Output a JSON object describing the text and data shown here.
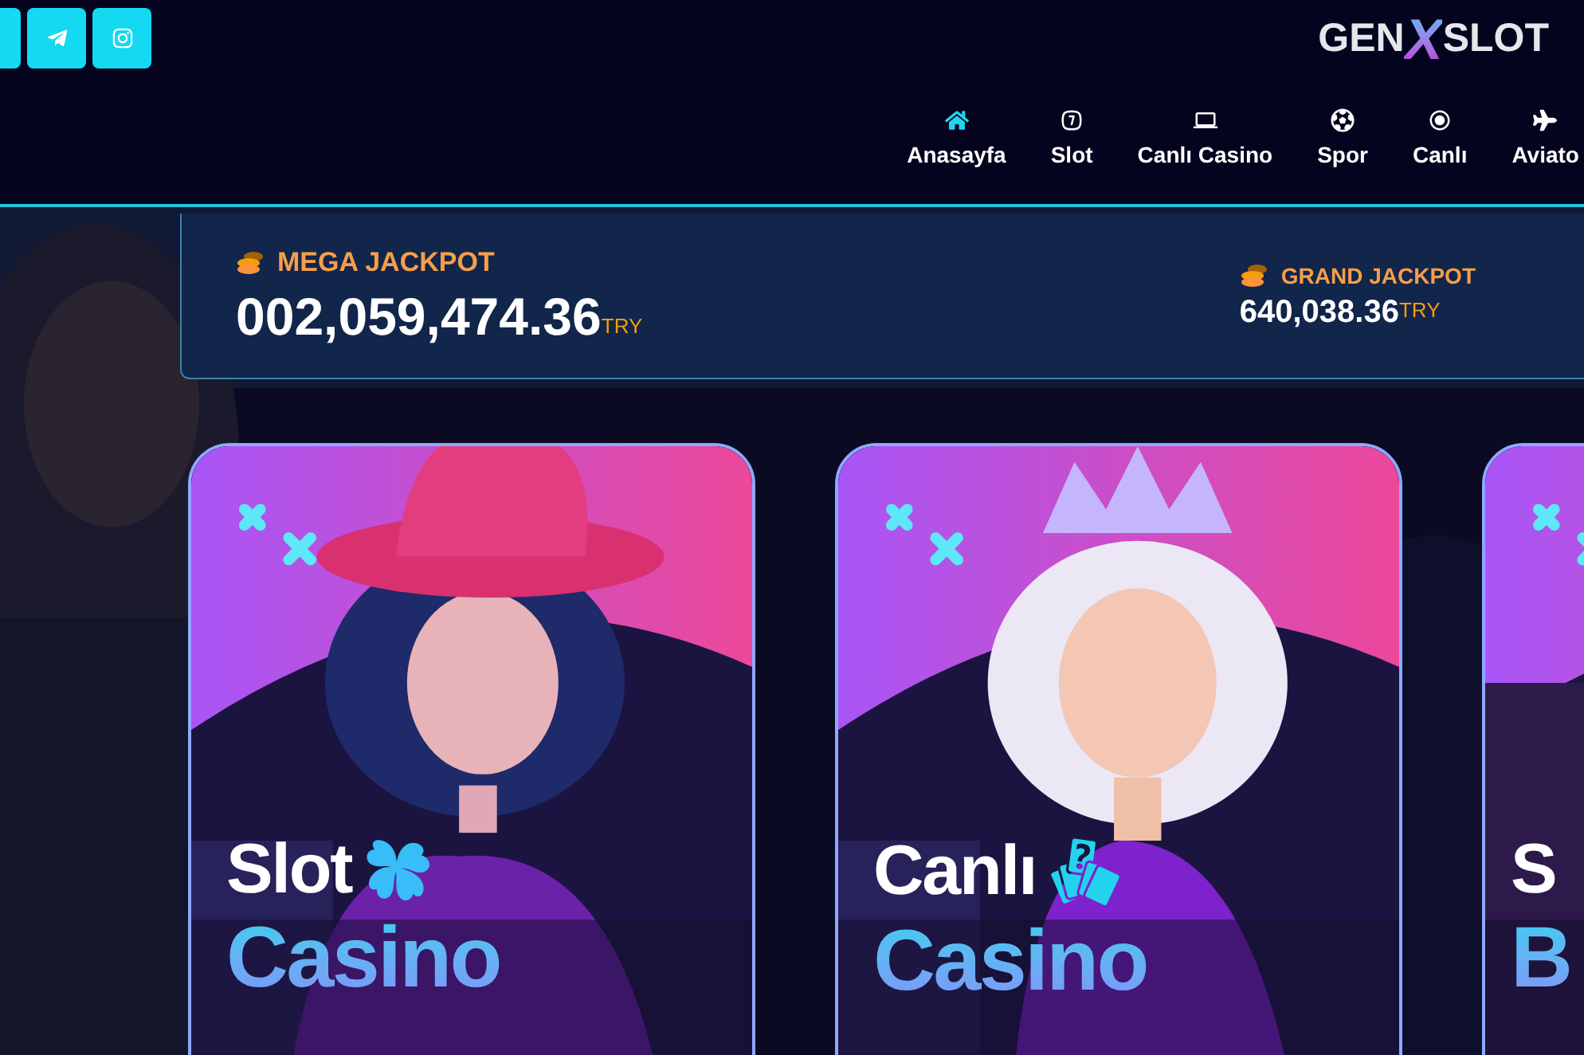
{
  "logo": {
    "left": "GEN",
    "middle": "X",
    "right": "SLOT"
  },
  "nav": [
    {
      "label": "Anasayfa",
      "selected": true
    },
    {
      "label": "Slot",
      "selected": false
    },
    {
      "label": "Canlı Casino",
      "selected": false
    },
    {
      "label": "Spor",
      "selected": false
    },
    {
      "label": "Canlı",
      "selected": false
    },
    {
      "label": "Aviato",
      "selected": false
    }
  ],
  "jackpots": [
    {
      "kind": "mega",
      "title": "MEGA JACKPOT",
      "amount": "002,059,474.36",
      "currency": "TRY"
    },
    {
      "kind": "grand",
      "title": "GRAND JACKPOT",
      "amount": "640,038.36",
      "currency": "TRY"
    }
  ],
  "cards": [
    {
      "title": "Slot",
      "subtitle": "Casino"
    },
    {
      "title": "Canlı",
      "subtitle": "Casino"
    },
    {
      "title": "S",
      "subtitle": "B"
    }
  ]
}
